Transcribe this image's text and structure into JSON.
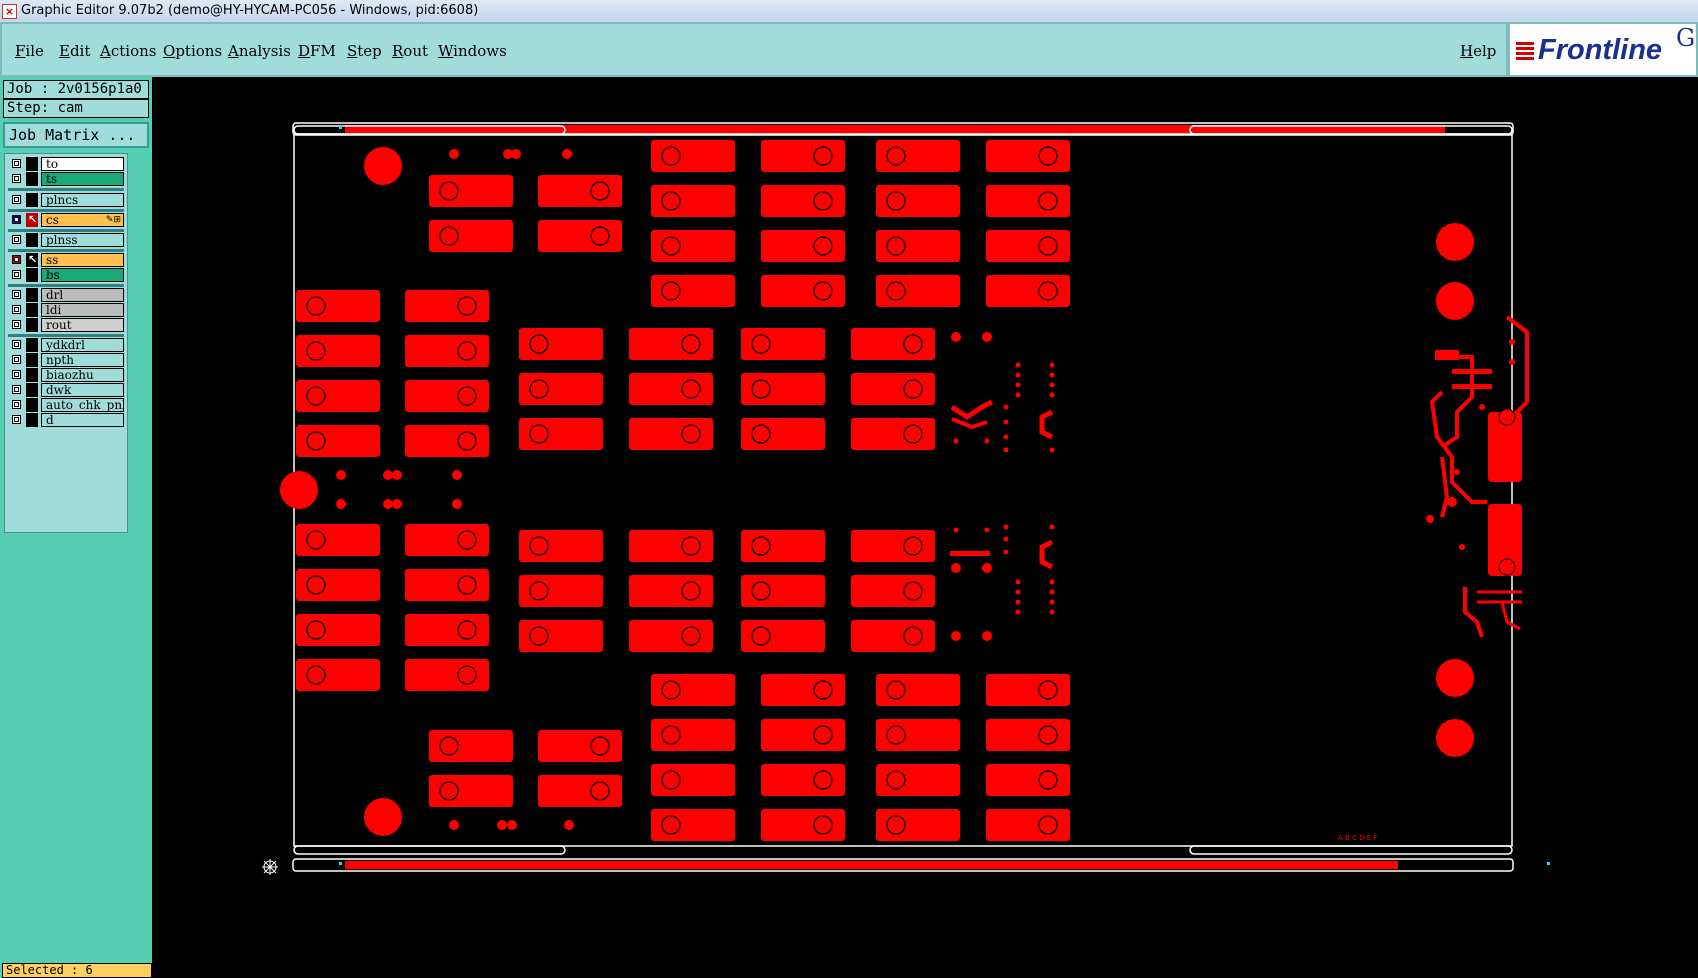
{
  "window": {
    "title": "Graphic Editor 9.07b2 (demo@HY-HYCAM-PC056 - Windows, pid:6608)",
    "app_icon": "x-app-icon"
  },
  "menu": {
    "items": [
      "File",
      "Edit",
      "Actions",
      "Options",
      "Analysis",
      "DFM",
      "Step",
      "Rout",
      "Windows"
    ],
    "help": "Help"
  },
  "logo": {
    "brand": "Frontline",
    "extra": "Ge"
  },
  "job": {
    "job_line": "Job : 2v0156p1a0",
    "step_line": "Step: cam",
    "matrix_button": "Job Matrix ..."
  },
  "layers": [
    {
      "name": "to",
      "color": "#ffffff",
      "affected": false,
      "work": false
    },
    {
      "name": "ts",
      "color": "#18a87a",
      "affected": false,
      "work": false
    },
    {
      "name": "plncs",
      "color": "#a1dcdc",
      "affected": false,
      "work": false
    },
    {
      "name": "cs",
      "color": "#ffc050",
      "affected": true,
      "work": true
    },
    {
      "name": "plnss",
      "color": "#a1dcdc",
      "affected": false,
      "work": false
    },
    {
      "name": "ss",
      "color": "#ffc050",
      "affected": true,
      "work": false
    },
    {
      "name": "bs",
      "color": "#18a87a",
      "affected": false,
      "work": false
    },
    {
      "name": "drl",
      "color": "#bcbcbc",
      "affected": false,
      "work": false
    },
    {
      "name": "ldi",
      "color": "#bcbcbc",
      "affected": false,
      "work": false
    },
    {
      "name": "rout",
      "color": "#cfcfcf",
      "affected": false,
      "work": false
    },
    {
      "name": "ydkdrl",
      "color": "#a1dcdc",
      "affected": false,
      "work": false
    },
    {
      "name": "npth",
      "color": "#a1dcdc",
      "affected": false,
      "work": false
    },
    {
      "name": "biaozhu",
      "color": "#a1dcdc",
      "affected": false,
      "work": false
    },
    {
      "name": "dwk",
      "color": "#a1dcdc",
      "affected": false,
      "work": false
    },
    {
      "name": "auto_chk_pnl",
      "color": "#a1dcdc",
      "affected": false,
      "work": false
    },
    {
      "name": "d",
      "color": "#a1dcdc",
      "affected": false,
      "work": false
    }
  ],
  "status": "Selected : 6",
  "canvas": {
    "feature_color": "#ff0000",
    "outline_color": "#ffffff",
    "background": "#000000",
    "marker_text": "A B C D E F"
  }
}
